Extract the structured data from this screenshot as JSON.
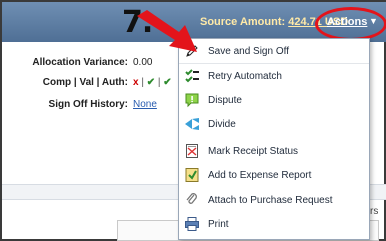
{
  "header": {
    "step_number": "7.",
    "source_amount_label": "Source Amount: ",
    "source_amount_value": "424.71 USD",
    "actions_label": "Actions",
    "actions_caret": "▼"
  },
  "details": {
    "allocation_variance_label": "Allocation Variance:",
    "allocation_variance_value": "0.00",
    "comp_val_auth_label": "Comp | Val | Auth:",
    "comp_status": "x",
    "sep_1": "|",
    "val_status": "✔",
    "sep_2": "|",
    "auth_status": "✔",
    "sign_off_history_label": "Sign Off History:",
    "sign_off_history_value": "None"
  },
  "actions_menu": {
    "items": [
      {
        "label": "Save and Sign Off",
        "icon": "pen-icon"
      },
      {
        "label": "Retry Automatch",
        "icon": "retry-automatch-icon"
      },
      {
        "label": "Dispute",
        "icon": "dispute-icon"
      },
      {
        "label": "Divide",
        "icon": "divide-icon"
      },
      {
        "label": "Mark Receipt Status",
        "icon": "receipt-icon"
      },
      {
        "label": "Add to Expense Report",
        "icon": "expense-report-icon"
      },
      {
        "label": "Attach to Purchase Request",
        "icon": "paperclip-icon"
      },
      {
        "label": "Print",
        "icon": "printer-icon"
      }
    ]
  },
  "snippets": {
    "right_edge_text": "rs"
  },
  "colors": {
    "header_top": "#6f8fb3",
    "header_bottom": "#4f6f95",
    "callout_red": "#e3141b",
    "link_blue": "#2a5db0",
    "source_amount_text": "#ffeaa8"
  }
}
